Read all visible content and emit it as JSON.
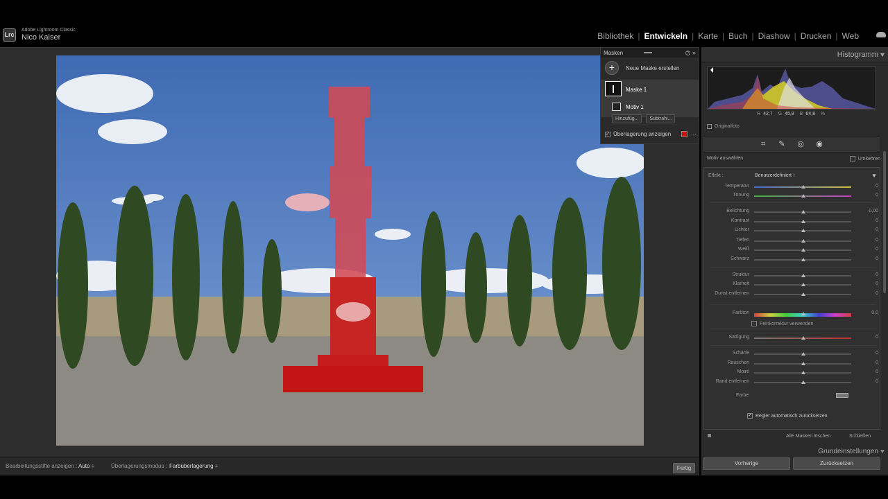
{
  "app": {
    "product": "Adobe Lightroom Classic",
    "logo": "Lrc",
    "user": "Nico Kaiser"
  },
  "modules": [
    "Bibliothek",
    "Entwickeln",
    "Karte",
    "Buch",
    "Diashow",
    "Drucken",
    "Web"
  ],
  "active_module": "Entwickeln",
  "masks_panel": {
    "title": "Masken",
    "new_mask": "Neue Maske erstellen",
    "mask_name": "Maske 1",
    "component": "Motiv 1",
    "add_label": "Hinzufüg...",
    "subtract_label": "Subtrahi...",
    "overlay_label": "Überlagerung anzeigen",
    "overlay_color": "#d01010"
  },
  "histogram": {
    "title": "Histogramm",
    "r_label": "R",
    "r": "42,7",
    "g_label": "G",
    "g": "45,8",
    "b_label": "B",
    "b": "64,8",
    "unit": "%",
    "original": "Originalfoto"
  },
  "mask_edit": {
    "subject": "Motiv auswählen",
    "invert": "Umkehren",
    "effect_label": "Effekt :",
    "effect_value": "Benutzerdefiniert ÷",
    "sliders": [
      {
        "label": "Temperatur",
        "value": "0"
      },
      {
        "label": "Tönung",
        "value": "0"
      },
      {
        "label": "Belichtung",
        "value": "0,00"
      },
      {
        "label": "Kontrast",
        "value": "0"
      },
      {
        "label": "Lichter",
        "value": "0"
      },
      {
        "label": "Tiefen",
        "value": "0"
      },
      {
        "label": "Weiß",
        "value": "0"
      },
      {
        "label": "Schwarz",
        "value": "0"
      },
      {
        "label": "Struktur",
        "value": "0"
      },
      {
        "label": "Klarheit",
        "value": "0"
      },
      {
        "label": "Dunst entfernen",
        "value": "0"
      },
      {
        "label": "Farbton",
        "value": "0,0"
      },
      {
        "label": "Sättigung",
        "value": "0"
      },
      {
        "label": "Schärfe",
        "value": "0"
      },
      {
        "label": "Rauschen",
        "value": "0"
      },
      {
        "label": "Moiré",
        "value": "0"
      },
      {
        "label": "Rand entfernen",
        "value": "0"
      }
    ],
    "finetune": "Feinkorrektur verwenden",
    "color_label": "Farbe",
    "auto_reset": "Regler automatisch zurücksetzen",
    "delete_all": "Alle Masken löschen",
    "close": "Schließen"
  },
  "basic_panel": "Grundeinstellungen",
  "footer_buttons": {
    "previous": "Vorherige",
    "reset": "Zurücksetzen"
  },
  "toolbar": {
    "pins_label": "Bearbeitungsstifte anzeigen :",
    "pins_value": "Auto ÷",
    "overlay_mode_label": "Überlagerungsmodus :",
    "overlay_mode_value": "Farbüberlagerung ÷",
    "done": "Fertig"
  }
}
